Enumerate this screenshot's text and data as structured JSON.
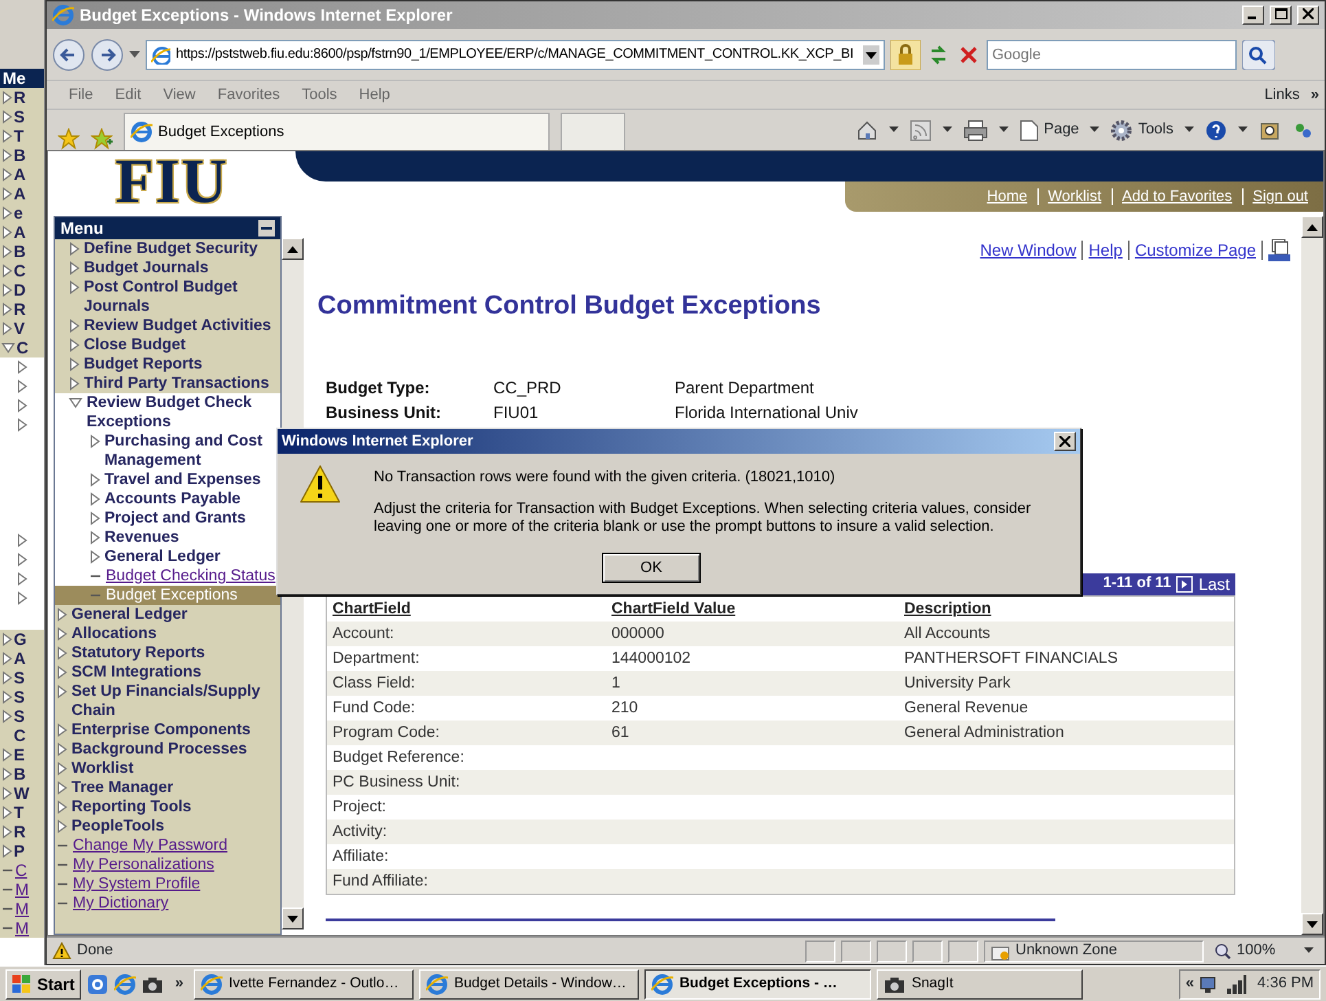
{
  "background_window": {
    "header": "Me",
    "items": [
      {
        "kind": "folder",
        "text": "R"
      },
      {
        "kind": "folder",
        "text": "S"
      },
      {
        "kind": "folder",
        "text": "T"
      },
      {
        "kind": "folder",
        "text": "B"
      },
      {
        "kind": "folder",
        "text": "A"
      },
      {
        "kind": "folder",
        "text": "A"
      },
      {
        "kind": "folder",
        "text": "e"
      },
      {
        "kind": "folder",
        "text": "A"
      },
      {
        "kind": "folder",
        "text": "B"
      },
      {
        "kind": "folder",
        "text": "C"
      },
      {
        "kind": "folder",
        "text": "D"
      },
      {
        "kind": "folder",
        "text": "R"
      },
      {
        "kind": "folder",
        "text": "V"
      },
      {
        "kind": "open",
        "text": "C"
      },
      {
        "kind": "child"
      },
      {
        "kind": "child"
      },
      {
        "kind": "child"
      },
      {
        "kind": "child"
      },
      {
        "kind": "gap"
      },
      {
        "kind": "child"
      },
      {
        "kind": "child"
      },
      {
        "kind": "child"
      },
      {
        "kind": "child"
      },
      {
        "kind": "blank"
      },
      {
        "kind": "folder",
        "text": "G"
      },
      {
        "kind": "folder",
        "text": "A"
      },
      {
        "kind": "folder",
        "text": "S"
      },
      {
        "kind": "folder",
        "text": "S"
      },
      {
        "kind": "folder",
        "text": "S"
      },
      {
        "kind": "wrap",
        "text": "C"
      },
      {
        "kind": "folder",
        "text": "E"
      },
      {
        "kind": "folder",
        "text": "B"
      },
      {
        "kind": "folder",
        "text": "W"
      },
      {
        "kind": "folder",
        "text": "T"
      },
      {
        "kind": "folder",
        "text": "R"
      },
      {
        "kind": "folder",
        "text": "P"
      },
      {
        "kind": "link",
        "text": "C"
      },
      {
        "kind": "link",
        "text": "M"
      },
      {
        "kind": "link",
        "text": "M"
      },
      {
        "kind": "link",
        "text": "M"
      }
    ]
  },
  "window": {
    "title": "Budget Exceptions - Windows Internet Explorer"
  },
  "address_bar": {
    "url": "https://pststweb.fiu.edu:8600/psp/fstrn90_1/EMPLOYEE/ERP/c/MANAGE_COMMITMENT_CONTROL.KK_XCP_BI",
    "search_placeholder": "Google"
  },
  "menu_bar": {
    "items": [
      "File",
      "Edit",
      "View",
      "Favorites",
      "Tools",
      "Help"
    ],
    "links": "Links",
    "links_chevron": "»"
  },
  "command_bar": {
    "tabs": [
      {
        "label": "Budget Exceptions",
        "selected": true
      }
    ],
    "page": "Page",
    "tools": "Tools"
  },
  "site_header": {
    "logo": "FIU",
    "links": [
      "Home",
      "Worklist",
      "Add to Favorites",
      "Sign out"
    ]
  },
  "menu": {
    "title": "Menu",
    "nested_items": [
      {
        "kind": "folder",
        "label": "Define Budget Security",
        "expanded": false,
        "selected": false
      },
      {
        "kind": "folder",
        "label": "Budget Journals",
        "expanded": false,
        "selected": false
      },
      {
        "kind": "folder",
        "label": "Post Control Budget Journals",
        "expanded": false,
        "selected": false
      },
      {
        "kind": "folder",
        "label": "Review Budget Activities",
        "expanded": false,
        "selected": false
      },
      {
        "kind": "folder",
        "label": "Close Budget",
        "expanded": false,
        "selected": false
      },
      {
        "kind": "folder",
        "label": "Budget Reports",
        "expanded": false,
        "selected": false
      },
      {
        "kind": "folder",
        "label": "Third Party Transactions",
        "expanded": false,
        "selected": false
      },
      {
        "kind": "folder",
        "label": "Review Budget Check Exceptions",
        "expanded": true,
        "selected": false,
        "children": [
          {
            "kind": "folder",
            "label": "Purchasing and Cost Management",
            "expanded": false,
            "selected": false
          },
          {
            "kind": "folder",
            "label": "Travel and Expenses",
            "expanded": false,
            "selected": false
          },
          {
            "kind": "folder",
            "label": "Accounts Payable",
            "expanded": false,
            "selected": false
          },
          {
            "kind": "folder",
            "label": "Project and Grants",
            "expanded": false,
            "selected": false
          },
          {
            "kind": "folder",
            "label": "Revenues",
            "expanded": false,
            "selected": false
          },
          {
            "kind": "folder",
            "label": "General Ledger",
            "expanded": false,
            "selected": false
          },
          {
            "kind": "link",
            "label": "Budget Checking Status",
            "selected": false
          },
          {
            "kind": "link",
            "label": "Budget Exceptions",
            "selected": true
          }
        ]
      }
    ],
    "items": [
      {
        "kind": "folder",
        "label": "General Ledger",
        "expanded": false,
        "selected": false
      },
      {
        "kind": "folder",
        "label": "Allocations",
        "expanded": false,
        "selected": false
      },
      {
        "kind": "folder",
        "label": "Statutory Reports",
        "expanded": false,
        "selected": false
      },
      {
        "kind": "folder",
        "label": "SCM Integrations",
        "expanded": false,
        "selected": false
      },
      {
        "kind": "folder",
        "label": "Set Up Financials/Supply Chain",
        "expanded": false,
        "selected": false
      },
      {
        "kind": "folder",
        "label": "Enterprise Components",
        "expanded": false,
        "selected": false
      },
      {
        "kind": "folder",
        "label": "Background Processes",
        "expanded": false,
        "selected": false
      },
      {
        "kind": "folder",
        "label": "Worklist",
        "expanded": false,
        "selected": false
      },
      {
        "kind": "folder",
        "label": "Tree Manager",
        "expanded": false,
        "selected": false
      },
      {
        "kind": "folder",
        "label": "Reporting Tools",
        "expanded": false,
        "selected": false
      },
      {
        "kind": "folder",
        "label": "PeopleTools",
        "expanded": false,
        "selected": false
      },
      {
        "kind": "link",
        "label": "Change My Password",
        "selected": false
      },
      {
        "kind": "link",
        "label": "My Personalizations",
        "selected": false
      },
      {
        "kind": "link",
        "label": "My System Profile",
        "selected": false
      },
      {
        "kind": "link",
        "label": "My Dictionary",
        "selected": false
      }
    ]
  },
  "page": {
    "links": [
      "New Window",
      "Help",
      "Customize Page"
    ],
    "title": "Commitment Control Budget Exceptions",
    "fields": [
      {
        "label": "Budget Type:",
        "value": "CC_PRD",
        "description": "Parent Department"
      },
      {
        "label": "Business Unit:",
        "value": "FIU01",
        "description": "Florida International Univ"
      }
    ],
    "grid": {
      "range": "1-11 of 11",
      "last": "Last",
      "columns": [
        "ChartField",
        "ChartField Value",
        "Description"
      ],
      "rows": [
        [
          "Account:",
          "000000",
          "All Accounts"
        ],
        [
          "Department:",
          "144000102",
          "PANTHERSOFT FINANCIALS"
        ],
        [
          "Class Field:",
          "1",
          "University Park"
        ],
        [
          "Fund Code:",
          "210",
          "General Revenue"
        ],
        [
          "Program Code:",
          "61",
          "General Administration"
        ],
        [
          "Budget Reference:",
          "",
          ""
        ],
        [
          "PC Business Unit:",
          "",
          ""
        ],
        [
          "Project:",
          "",
          ""
        ],
        [
          "Activity:",
          "",
          ""
        ],
        [
          "Affiliate:",
          "",
          ""
        ],
        [
          "Fund Affiliate:",
          "",
          ""
        ]
      ]
    }
  },
  "dialog": {
    "title": "Windows Internet Explorer",
    "message": "No Transaction rows were found with the given criteria. (18021,1010)",
    "detail": "Adjust the criteria for Transaction with Budget Exceptions. When selecting criteria values, consider leaving one or more of the criteria blank or use the prompt buttons to insure a valid selection.",
    "button": "OK"
  },
  "status_bar": {
    "text": "Done",
    "zone": "Unknown Zone",
    "zoom": "100%"
  },
  "taskbar": {
    "start": "Start",
    "chevron": "»",
    "tasks": [
      {
        "label": "Ivette Fernandez - Outlo…",
        "selected": false
      },
      {
        "label": "Budget Details - Window…",
        "selected": false
      },
      {
        "label": "Budget Exceptions - …",
        "selected": true
      },
      {
        "label": "SnagIt",
        "selected": false
      }
    ],
    "tray_chevron": "«",
    "clock": "4:36 PM"
  }
}
